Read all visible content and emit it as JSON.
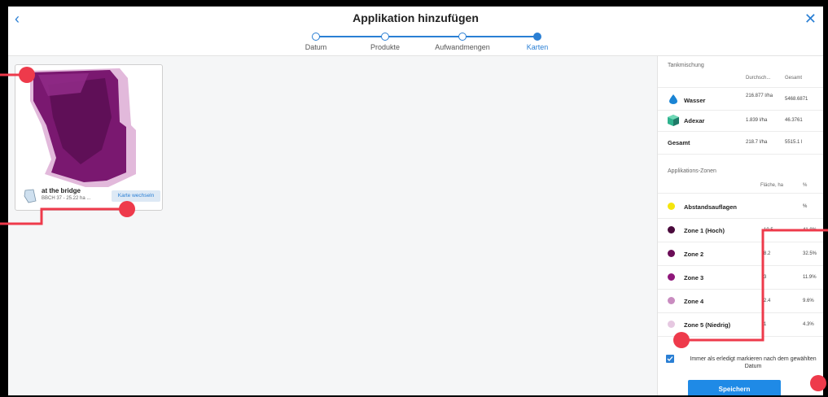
{
  "header": {
    "title": "Applikation hinzufügen",
    "back_icon": "‹",
    "close_icon": "✕"
  },
  "steps": [
    {
      "label": "Datum",
      "state": "done"
    },
    {
      "label": "Produkte",
      "state": "done"
    },
    {
      "label": "Aufwandmengen",
      "state": "done"
    },
    {
      "label": "Karten",
      "state": "active"
    }
  ],
  "map_card": {
    "title": "at the bridge",
    "subtitle": "BBCH 37 - 25.22 ha ...",
    "button_label": "Karte wechseln"
  },
  "sidebar": {
    "tank_title": "Tankmischung",
    "col_avg": "Durchsch...",
    "col_total": "Gesamt",
    "products": [
      {
        "name": "Wasser",
        "rate": "216.877 l/ha",
        "total": "5468.6871",
        "icon": "water-drop-icon"
      },
      {
        "name": "Adexar",
        "rate": "1.839 l/ha",
        "total": "46.3761",
        "icon": "product-box-icon"
      }
    ],
    "sum_label": "Gesamt",
    "sum_rate": "218.7 l/ha",
    "sum_total": "5515.1 l",
    "zones_title": "Applikations-Zonen",
    "col_area": "Fläche, ha",
    "col_pct": "%",
    "zones": [
      {
        "name": "Abstandsauflagen",
        "area": "",
        "pct": "%",
        "color": "#f5e50d"
      },
      {
        "name": "Zone 1 (Hoch)",
        "area": "10.5",
        "pct": "41.8%",
        "color": "#4a0a3c"
      },
      {
        "name": "Zone 2",
        "area": "8.2",
        "pct": "32.5%",
        "color": "#6b0d57"
      },
      {
        "name": "Zone 3",
        "area": "3",
        "pct": "11.9%",
        "color": "#8f177a"
      },
      {
        "name": "Zone 4",
        "area": "2.4",
        "pct": "9.6%",
        "color": "#c98cc0"
      },
      {
        "name": "Zone 5 (Niedrig)",
        "area": "1",
        "pct": "4.3%",
        "color": "#e6c8e1"
      }
    ],
    "checkbox_text": "Immer als erledigt markieren nach dem gewählten Datum",
    "checkbox_checked": true,
    "save_label": "Speichern"
  },
  "colors": {
    "accent": "#2a7fd4",
    "annotation": "#ee3a4b"
  }
}
